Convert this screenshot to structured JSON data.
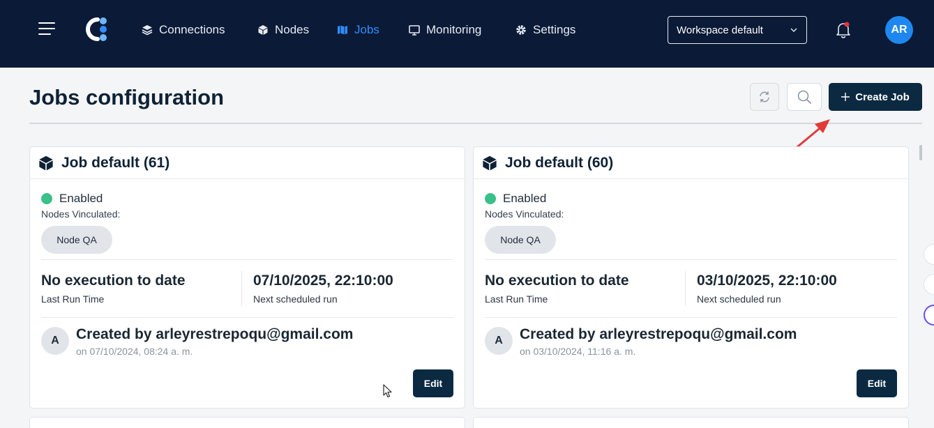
{
  "nav": {
    "items": [
      {
        "label": "Connections",
        "icon": "layers-icon"
      },
      {
        "label": "Nodes",
        "icon": "cube-icon"
      },
      {
        "label": "Jobs",
        "icon": "map-icon",
        "active": true
      },
      {
        "label": "Monitoring",
        "icon": "monitor-icon"
      },
      {
        "label": "Settings",
        "icon": "gear-icon"
      }
    ],
    "workspace_selected": "Workspace default",
    "user_initials": "AR"
  },
  "page": {
    "title": "Jobs configuration",
    "create_label": "Create Job"
  },
  "jobs": [
    {
      "title": "Job default (61)",
      "status": "Enabled",
      "nodes_label": "Nodes Vinculated:",
      "nodes": [
        "Node QA"
      ],
      "last_run_value": "No execution to date",
      "last_run_label": "Last Run Time",
      "next_run_value": "07/10/2025, 22:10:00",
      "next_run_label": "Next scheduled run",
      "creator_initial": "A",
      "created_by": "Created by arleyrestrepoqu@gmail.com",
      "created_on": "on 07/10/2024, 08:24 a. m.",
      "edit_label": "Edit"
    },
    {
      "title": "Job default (60)",
      "status": "Enabled",
      "nodes_label": "Nodes Vinculated:",
      "nodes": [
        "Node QA"
      ],
      "last_run_value": "No execution to date",
      "last_run_label": "Last Run Time",
      "next_run_value": "03/10/2025, 22:10:00",
      "next_run_label": "Next scheduled run",
      "creator_initial": "A",
      "created_by": "Created by arleyrestrepoqu@gmail.com",
      "created_on": "on 03/10/2024, 11:16 a. m.",
      "edit_label": "Edit"
    }
  ],
  "colors": {
    "topbar": "#0b1a36",
    "accent_active": "#2f8dff",
    "primary_button": "#0b2a42",
    "status_enabled": "#3ac08a",
    "annotation_arrow": "#e03a3a"
  }
}
